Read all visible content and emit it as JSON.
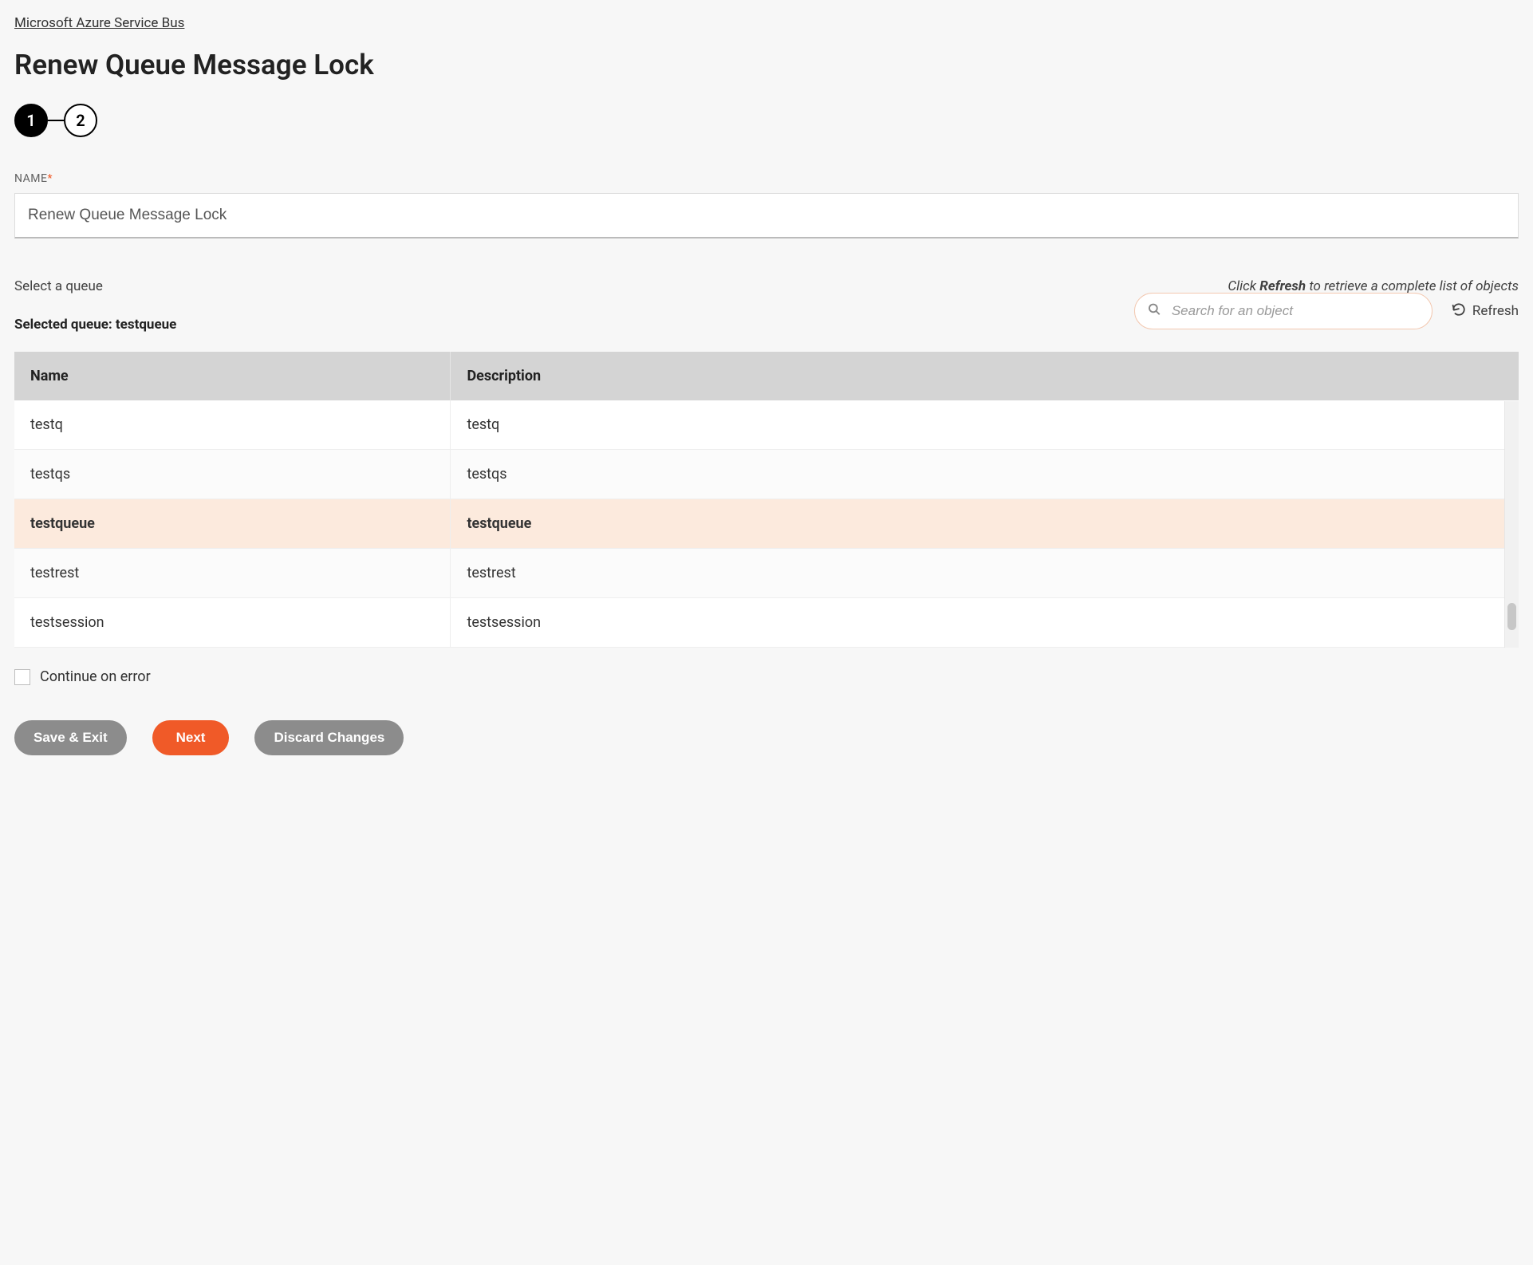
{
  "breadcrumb": {
    "label": "Microsoft Azure Service Bus"
  },
  "page": {
    "title": "Renew Queue Message Lock"
  },
  "steps": {
    "one": "1",
    "two": "2"
  },
  "name_field": {
    "label": "NAME",
    "value": "Renew Queue Message Lock"
  },
  "queue_section": {
    "select_label": "Select a queue",
    "hint_pre": "Click ",
    "hint_bold": "Refresh",
    "hint_post": " to retrieve a complete list of objects",
    "selected_prefix": "Selected queue: ",
    "selected_value": "testqueue"
  },
  "search": {
    "placeholder": "Search for an object"
  },
  "refresh": {
    "label": "Refresh"
  },
  "table": {
    "headers": {
      "name": "Name",
      "description": "Description"
    },
    "rows": [
      {
        "name": "testq",
        "description": "testq",
        "selected": false
      },
      {
        "name": "testqs",
        "description": "testqs",
        "selected": false
      },
      {
        "name": "testqueue",
        "description": "testqueue",
        "selected": true
      },
      {
        "name": "testrest",
        "description": "testrest",
        "selected": false
      },
      {
        "name": "testsession",
        "description": "testsession",
        "selected": false
      }
    ]
  },
  "continue_on_error": {
    "label": "Continue on error",
    "checked": false
  },
  "buttons": {
    "save_exit": "Save & Exit",
    "next": "Next",
    "discard": "Discard Changes"
  }
}
